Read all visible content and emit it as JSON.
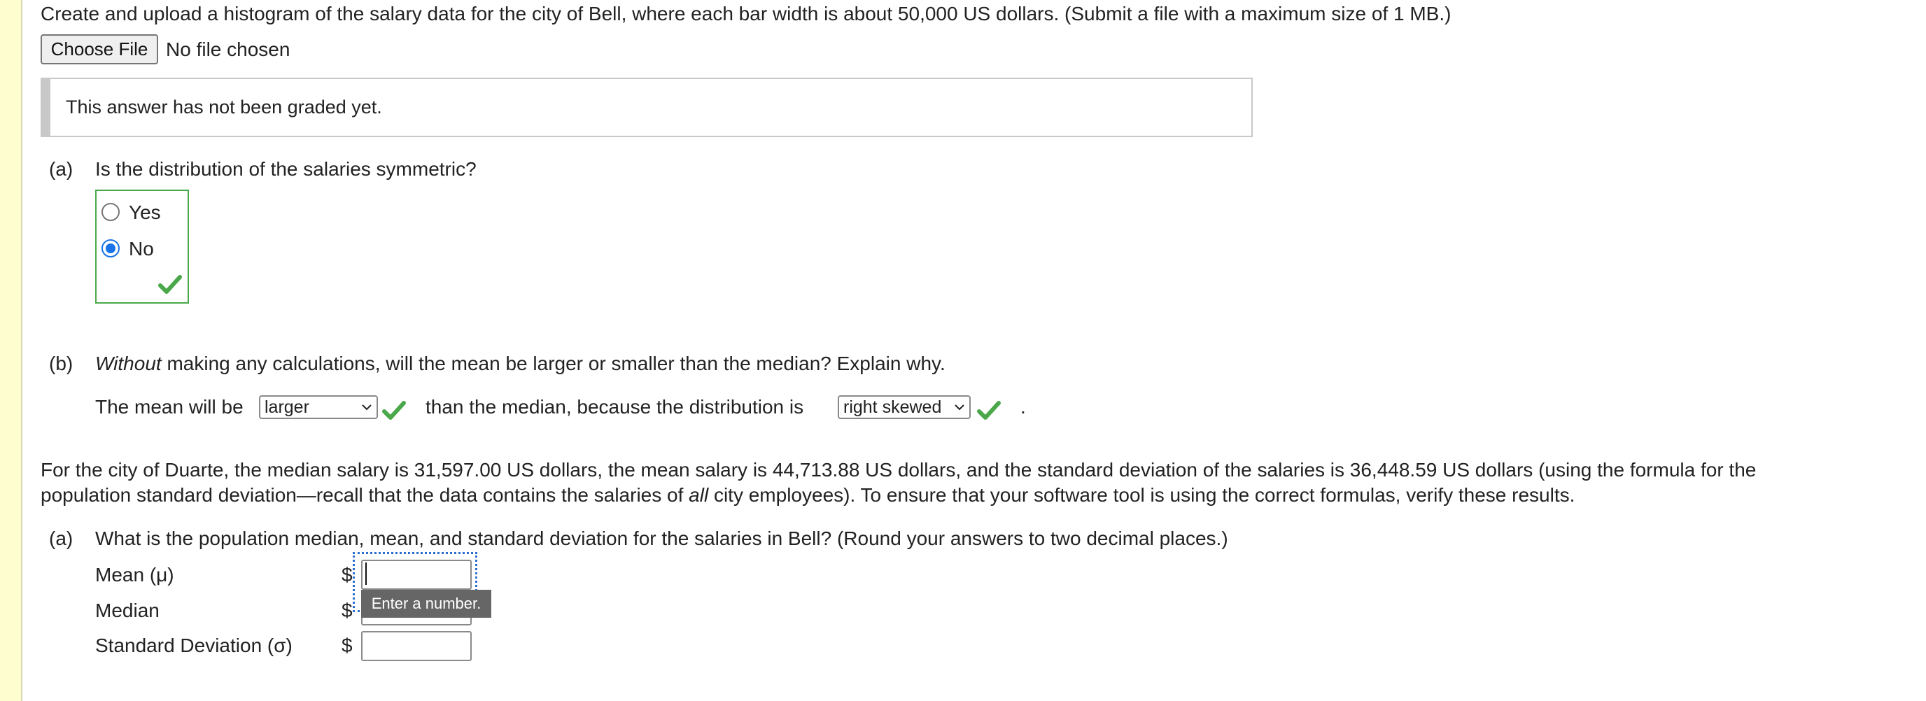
{
  "upload": {
    "prompt": "Create and upload a histogram of the salary data for the city of Bell, where each bar width is about 50,000 US dollars. (Submit a file with a maximum size of 1 MB.)",
    "button_label": "Choose File",
    "file_status": "No file chosen"
  },
  "graded_note": "This answer has not been graded yet.",
  "qa": {
    "marker": "(a)",
    "question": "Is the distribution of the salaries symmetric?",
    "options": [
      "Yes",
      "No"
    ],
    "selected": "No"
  },
  "qb": {
    "marker": "(b)",
    "question_em": "Without",
    "question_rest": " making any calculations, will the mean be larger or smaller than the median? Explain why.",
    "sentence_part1": "The mean will be",
    "select1_value": "larger",
    "sentence_part2": "than the median, because the distribution is",
    "select2_value": "right skewed",
    "sentence_end": "."
  },
  "duarte": {
    "line1": "For the city of Duarte, the median salary is 31,597.00 US dollars, the mean salary is 44,713.88 US dollars, and the standard deviation of the salaries is 36,448.59 US dollars (using the formula for the",
    "line2_a": "population standard deviation—recall that the data contains the salaries of ",
    "line2_em": "all",
    "line2_b": " city employees). To ensure that your software tool is using the correct formulas, verify these results."
  },
  "qc": {
    "marker": "(a)",
    "question": "What is the population median, mean, and standard deviation for the salaries in Bell? (Round your answers to two decimal places.)",
    "rows": [
      {
        "label": "Mean (μ)",
        "prefix": "$",
        "value": ""
      },
      {
        "label": "Median",
        "prefix": "$",
        "value": ""
      },
      {
        "label": "Standard Deviation (σ)",
        "prefix": "$",
        "value": ""
      }
    ],
    "tooltip": "Enter a number."
  },
  "colors": {
    "correct": "#4aa84a",
    "rail": "#fdfdd0",
    "focus": "#2a6fd0",
    "radio_selected": "#1a73e8"
  },
  "icons": [
    "checkmark-icon",
    "chevron-down-icon"
  ]
}
